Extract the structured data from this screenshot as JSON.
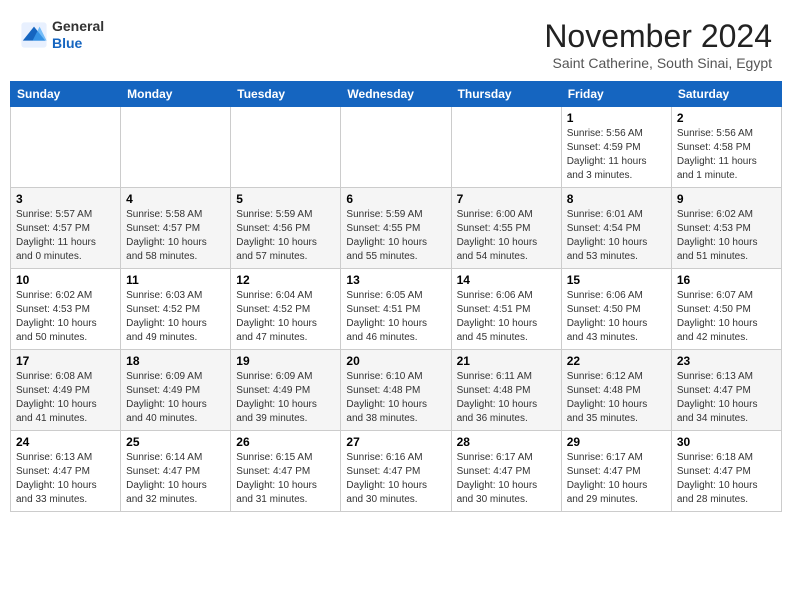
{
  "header": {
    "logo_line1": "General",
    "logo_line2": "Blue",
    "month": "November 2024",
    "location": "Saint Catherine, South Sinai, Egypt"
  },
  "weekdays": [
    "Sunday",
    "Monday",
    "Tuesday",
    "Wednesday",
    "Thursday",
    "Friday",
    "Saturday"
  ],
  "weeks": [
    [
      {
        "day": "",
        "info": ""
      },
      {
        "day": "",
        "info": ""
      },
      {
        "day": "",
        "info": ""
      },
      {
        "day": "",
        "info": ""
      },
      {
        "day": "",
        "info": ""
      },
      {
        "day": "1",
        "info": "Sunrise: 5:56 AM\nSunset: 4:59 PM\nDaylight: 11 hours\nand 3 minutes."
      },
      {
        "day": "2",
        "info": "Sunrise: 5:56 AM\nSunset: 4:58 PM\nDaylight: 11 hours\nand 1 minute."
      }
    ],
    [
      {
        "day": "3",
        "info": "Sunrise: 5:57 AM\nSunset: 4:57 PM\nDaylight: 11 hours\nand 0 minutes."
      },
      {
        "day": "4",
        "info": "Sunrise: 5:58 AM\nSunset: 4:57 PM\nDaylight: 10 hours\nand 58 minutes."
      },
      {
        "day": "5",
        "info": "Sunrise: 5:59 AM\nSunset: 4:56 PM\nDaylight: 10 hours\nand 57 minutes."
      },
      {
        "day": "6",
        "info": "Sunrise: 5:59 AM\nSunset: 4:55 PM\nDaylight: 10 hours\nand 55 minutes."
      },
      {
        "day": "7",
        "info": "Sunrise: 6:00 AM\nSunset: 4:55 PM\nDaylight: 10 hours\nand 54 minutes."
      },
      {
        "day": "8",
        "info": "Sunrise: 6:01 AM\nSunset: 4:54 PM\nDaylight: 10 hours\nand 53 minutes."
      },
      {
        "day": "9",
        "info": "Sunrise: 6:02 AM\nSunset: 4:53 PM\nDaylight: 10 hours\nand 51 minutes."
      }
    ],
    [
      {
        "day": "10",
        "info": "Sunrise: 6:02 AM\nSunset: 4:53 PM\nDaylight: 10 hours\nand 50 minutes."
      },
      {
        "day": "11",
        "info": "Sunrise: 6:03 AM\nSunset: 4:52 PM\nDaylight: 10 hours\nand 49 minutes."
      },
      {
        "day": "12",
        "info": "Sunrise: 6:04 AM\nSunset: 4:52 PM\nDaylight: 10 hours\nand 47 minutes."
      },
      {
        "day": "13",
        "info": "Sunrise: 6:05 AM\nSunset: 4:51 PM\nDaylight: 10 hours\nand 46 minutes."
      },
      {
        "day": "14",
        "info": "Sunrise: 6:06 AM\nSunset: 4:51 PM\nDaylight: 10 hours\nand 45 minutes."
      },
      {
        "day": "15",
        "info": "Sunrise: 6:06 AM\nSunset: 4:50 PM\nDaylight: 10 hours\nand 43 minutes."
      },
      {
        "day": "16",
        "info": "Sunrise: 6:07 AM\nSunset: 4:50 PM\nDaylight: 10 hours\nand 42 minutes."
      }
    ],
    [
      {
        "day": "17",
        "info": "Sunrise: 6:08 AM\nSunset: 4:49 PM\nDaylight: 10 hours\nand 41 minutes."
      },
      {
        "day": "18",
        "info": "Sunrise: 6:09 AM\nSunset: 4:49 PM\nDaylight: 10 hours\nand 40 minutes."
      },
      {
        "day": "19",
        "info": "Sunrise: 6:09 AM\nSunset: 4:49 PM\nDaylight: 10 hours\nand 39 minutes."
      },
      {
        "day": "20",
        "info": "Sunrise: 6:10 AM\nSunset: 4:48 PM\nDaylight: 10 hours\nand 38 minutes."
      },
      {
        "day": "21",
        "info": "Sunrise: 6:11 AM\nSunset: 4:48 PM\nDaylight: 10 hours\nand 36 minutes."
      },
      {
        "day": "22",
        "info": "Sunrise: 6:12 AM\nSunset: 4:48 PM\nDaylight: 10 hours\nand 35 minutes."
      },
      {
        "day": "23",
        "info": "Sunrise: 6:13 AM\nSunset: 4:47 PM\nDaylight: 10 hours\nand 34 minutes."
      }
    ],
    [
      {
        "day": "24",
        "info": "Sunrise: 6:13 AM\nSunset: 4:47 PM\nDaylight: 10 hours\nand 33 minutes."
      },
      {
        "day": "25",
        "info": "Sunrise: 6:14 AM\nSunset: 4:47 PM\nDaylight: 10 hours\nand 32 minutes."
      },
      {
        "day": "26",
        "info": "Sunrise: 6:15 AM\nSunset: 4:47 PM\nDaylight: 10 hours\nand 31 minutes."
      },
      {
        "day": "27",
        "info": "Sunrise: 6:16 AM\nSunset: 4:47 PM\nDaylight: 10 hours\nand 30 minutes."
      },
      {
        "day": "28",
        "info": "Sunrise: 6:17 AM\nSunset: 4:47 PM\nDaylight: 10 hours\nand 30 minutes."
      },
      {
        "day": "29",
        "info": "Sunrise: 6:17 AM\nSunset: 4:47 PM\nDaylight: 10 hours\nand 29 minutes."
      },
      {
        "day": "30",
        "info": "Sunrise: 6:18 AM\nSunset: 4:47 PM\nDaylight: 10 hours\nand 28 minutes."
      }
    ]
  ]
}
